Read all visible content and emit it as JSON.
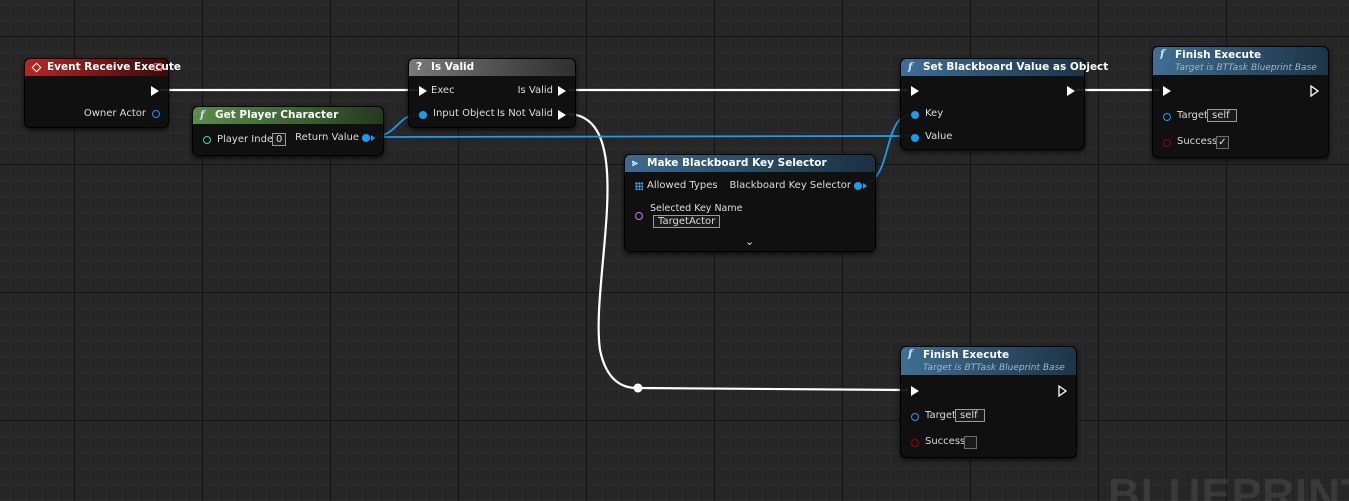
{
  "nodes": {
    "event_receive_execute": {
      "title": "Event Receive Execute",
      "pins": {
        "owner_actor": "Owner Actor"
      }
    },
    "get_player_character": {
      "title": "Get Player Character",
      "pins": {
        "player_index": "Player Index",
        "player_index_value": "0",
        "return_value": "Return Value"
      }
    },
    "is_valid": {
      "title": "Is Valid",
      "icon": "?",
      "pins": {
        "exec": "Exec",
        "input_object": "Input Object",
        "is_valid": "Is Valid",
        "is_not_valid": "Is Not Valid"
      }
    },
    "make_bb_key_selector": {
      "title": "Make Blackboard Key Selector",
      "pins": {
        "allowed_types": "Allowed Types",
        "blackboard_key_selector": "Blackboard Key Selector",
        "selected_key_name": "Selected Key Name",
        "selected_key_name_value": "TargetActor"
      }
    },
    "set_bb_value_as_object": {
      "title": "Set Blackboard Value as Object",
      "pins": {
        "key": "Key",
        "value": "Value"
      }
    },
    "finish_execute_1": {
      "title": "Finish Execute",
      "subtitle": "Target is BTTask Blueprint Base",
      "pins": {
        "target": "Target",
        "target_value": "self",
        "success": "Success"
      },
      "success_checked": true
    },
    "finish_execute_2": {
      "title": "Finish Execute",
      "subtitle": "Target is BTTask Blueprint Base",
      "pins": {
        "target": "Target",
        "target_value": "self",
        "success": "Success"
      },
      "success_checked": false
    }
  },
  "watermark": "BLUEPRINT",
  "icons": {
    "event": "event-diamond-icon",
    "function": "function-f-icon",
    "macro": "question-icon",
    "make_struct": "make-struct-icon"
  },
  "colors": {
    "exec_wire": "#ffffff",
    "object_wire": "#1a9cf0",
    "bool_pin": "#a10000",
    "name_pin": "#c879ff",
    "int_pin": "#1fe3af"
  }
}
